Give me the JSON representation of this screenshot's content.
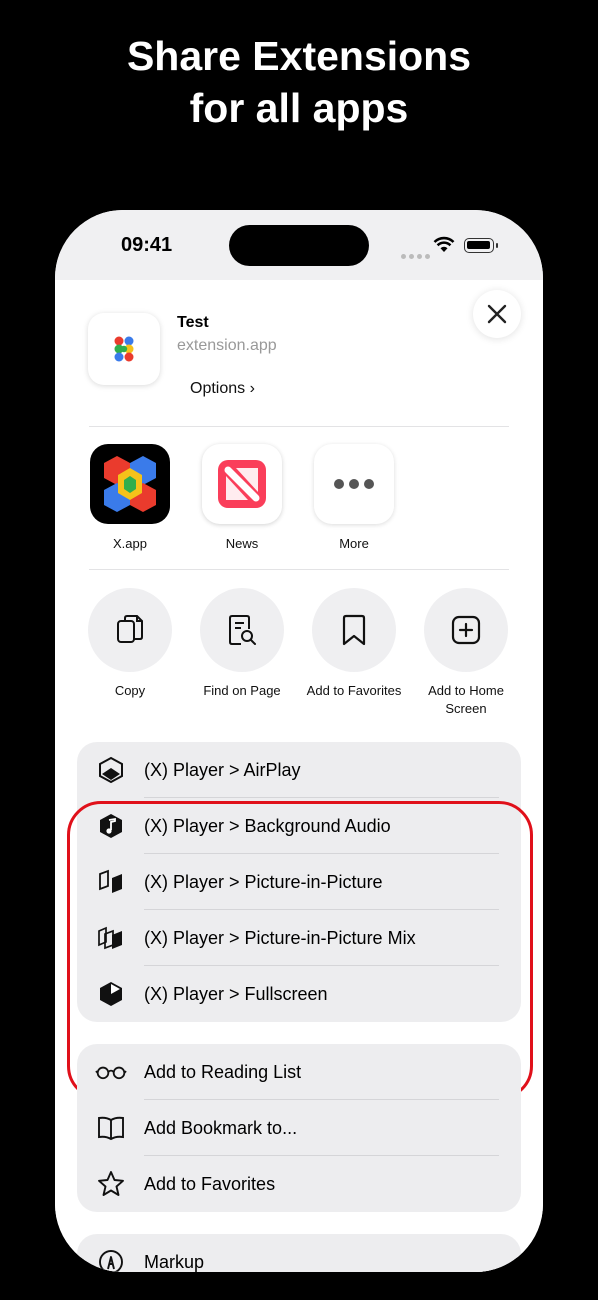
{
  "headline": [
    "Share Extensions",
    "for all apps"
  ],
  "status_bar": {
    "time": "09:41"
  },
  "share_header": {
    "title": "Test",
    "subtitle": "extension.app",
    "options_label": "Options ›"
  },
  "apps": [
    {
      "label": "X.app",
      "icon": "x-app-icon"
    },
    {
      "label": "News",
      "icon": "news-icon"
    },
    {
      "label": "More",
      "icon": "more-icon"
    }
  ],
  "actions": [
    {
      "label": "Copy",
      "icon": "copy-icon"
    },
    {
      "label": "Find on Page",
      "icon": "find-on-page-icon"
    },
    {
      "label": "Add to Favorites",
      "icon": "bookmark-icon"
    },
    {
      "label": "Add to Home Screen",
      "icon": "add-square-icon"
    }
  ],
  "player_group": [
    {
      "label": "(X) Player > AirPlay",
      "icon": "airplay-cube-icon"
    },
    {
      "label": "(X) Player > Background Audio",
      "icon": "music-note-hexagon-icon"
    },
    {
      "label": "(X) Player > Picture-in-Picture",
      "icon": "pip-panels-icon"
    },
    {
      "label": "(X) Player > Picture-in-Picture Mix",
      "icon": "pip-mix-icon"
    },
    {
      "label": "(X) Player > Fullscreen",
      "icon": "fullscreen-cube-icon"
    }
  ],
  "safari_group": [
    {
      "label": "Add to Reading List",
      "icon": "glasses-icon"
    },
    {
      "label": "Add Bookmark to...",
      "icon": "book-icon"
    },
    {
      "label": "Add to Favorites",
      "icon": "star-icon"
    }
  ],
  "markup_group": [
    {
      "label": "Markup",
      "icon": "markup-pen-icon"
    }
  ],
  "colors": {
    "highlight": "#e0101a",
    "group_bg": "#ededef"
  }
}
